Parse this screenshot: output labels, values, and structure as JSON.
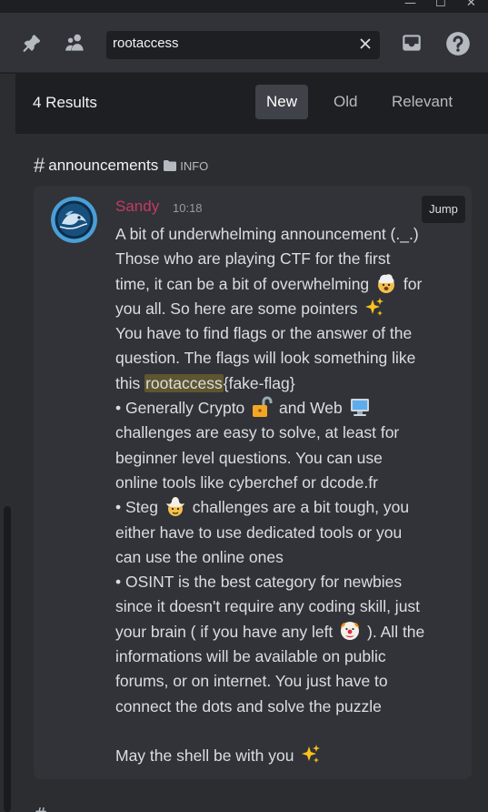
{
  "window": {
    "minimize": "—",
    "maximize": "☐",
    "close": "✕"
  },
  "toolbar": {
    "pin_icon": "pin-icon",
    "members_icon": "members-icon",
    "search": {
      "value": "rootaccess",
      "clear_icon": "close-icon"
    },
    "inbox_icon": "inbox-icon",
    "help_icon": "help-icon"
  },
  "results": {
    "count_label": "4 Results",
    "sort_tabs": [
      {
        "label": "New",
        "active": true
      },
      {
        "label": "Old",
        "active": false
      },
      {
        "label": "Relevant",
        "active": false
      }
    ],
    "channel": {
      "hash": "#",
      "name": "announcements",
      "category": "INFO"
    },
    "message": {
      "author": "Sandy",
      "author_color": "#c43b60",
      "time": "10:18",
      "jump_label": "Jump",
      "lines": {
        "l1": "A bit of underwhelming announcement (._.)",
        "l2": "Those who are playing CTF for the first",
        "l3a": "time, it can be a bit of overwhelming",
        "l3b": "for",
        "l4": "you all. So here are some pointers",
        "l5": "You have to find flags or the answer of the",
        "l6": "question. The flags will look something like",
        "l7a": "this",
        "l7hl": "rootaccess",
        "l7b": "{fake-flag}",
        "l8a": "• Generally Crypto",
        "l8b": "and Web",
        "l9": "challenges are easy to solve, at least for",
        "l10": "beginner level questions. You can use",
        "l11": "online tools like cyberchef or dcode.fr",
        "l12a": "• Steg",
        "l12b": "challenges are a bit tough, you",
        "l13": "either have to use dedicated tools or you",
        "l14": "can use the online ones",
        "l15": "• OSINT  is the best category for newbies",
        "l16": "since it doesn't require any coding skill, just",
        "l17a": "your brain ( if you have any left",
        "l17b": "). All the",
        "l18": "informations will be available on public",
        "l19": "forums, or on internet. You just have to",
        "l20": "connect the dots and solve the puzzle",
        "l21": "",
        "l22": "May the shell be with you"
      },
      "emojis": [
        "exploding-head-emoji",
        "sparkles-emoji",
        "lock-emoji",
        "computer-emoji",
        "cowboy-emoji",
        "clown-emoji"
      ]
    }
  },
  "colors": {
    "background": "#2b2d31",
    "card": "#313338",
    "highlight": "#5e5630"
  }
}
